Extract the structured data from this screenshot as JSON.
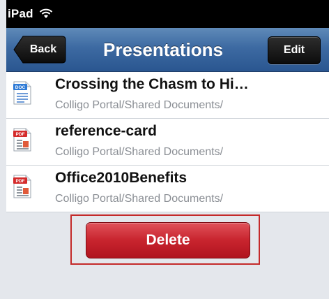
{
  "status_bar": {
    "device": "iPad"
  },
  "nav": {
    "back_label": "Back",
    "title": "Presentations",
    "edit_label": "Edit"
  },
  "files": [
    {
      "name": "Crossing the Chasm to Hi…",
      "path": "Colligo Portal/Shared Documents/",
      "type": "DOC",
      "icon": "doc-file-icon"
    },
    {
      "name": "reference-card",
      "path": "Colligo Portal/Shared Documents/",
      "type": "PDF",
      "icon": "pdf-file-icon"
    },
    {
      "name": "Office2010Benefits",
      "path": "Colligo Portal/Shared Documents/",
      "type": "PDF",
      "icon": "pdf-file-icon"
    }
  ],
  "actions": {
    "delete_label": "Delete"
  },
  "colors": {
    "nav": "#3d6aa2",
    "delete": "#c8242e",
    "doc_badge": "#2f7bd6",
    "pdf_badge": "#d42b2b",
    "highlight": "#c42a2a"
  }
}
